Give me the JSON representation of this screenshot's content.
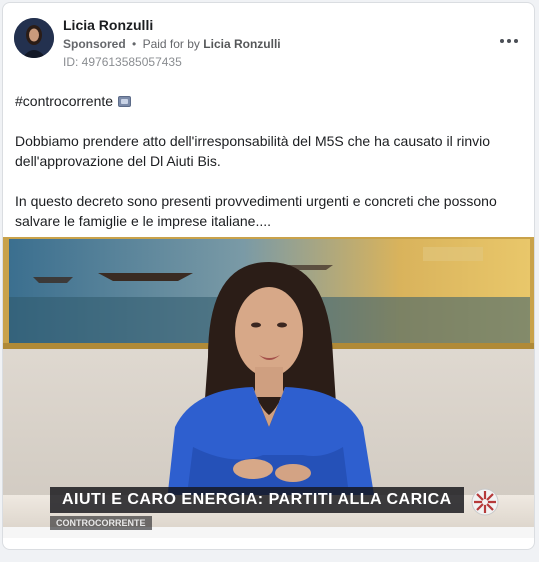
{
  "post": {
    "advertiser": "Licia Ronzulli",
    "sponsored_label": "Sponsored",
    "separator": "•",
    "paid_for_label": "Paid for by",
    "paid_for_name": "Licia Ronzulli",
    "ad_id": "ID: 497613585057435",
    "more_icon": "more-options-icon"
  },
  "body": {
    "hashtag": "#controcorrente",
    "hashtag_icon": "tv-icon",
    "paragraph1": "Dobbiamo prendere atto dell'irresponsabilità del M5S che ha causato il rinvio dell'approvazione del Dl Aiuti Bis.",
    "paragraph2": "In questo decreto sono presenti provvedimenti urgenti e concreti che possono salvare le famiglie e le imprese italiane...."
  },
  "media": {
    "banner_text": "AIUTI E CARO ENERGIA: PARTITI ALLA CARICA",
    "banner_sub": "CONTROCORRENTE",
    "colors": {
      "banner_bg": "#141418",
      "blouse": "#2e5fcf",
      "frame": "#c9a24a"
    }
  }
}
